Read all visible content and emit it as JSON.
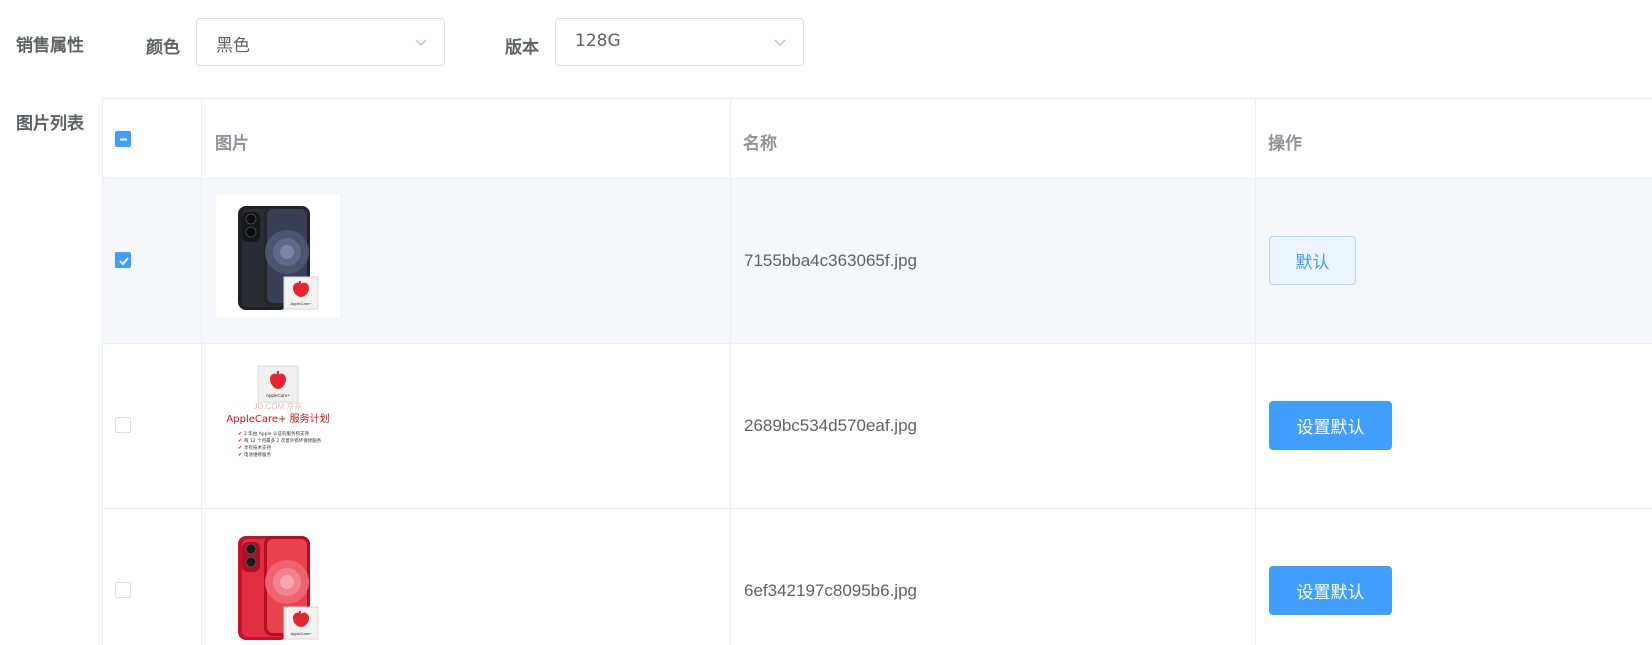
{
  "sales_attr": {
    "label": "销售属性",
    "color_label": "颜色",
    "color_value": "黑色",
    "version_label": "版本",
    "version_value": "128G"
  },
  "image_list": {
    "label": "图片列表",
    "columns": [
      "图片",
      "名称",
      "操作"
    ],
    "rows": [
      {
        "checked": true,
        "image_icon": "iphone-black-applecare-image",
        "name": "7155bba4c363065f.jpg",
        "action_label": "默认",
        "action_style": "plain"
      },
      {
        "checked": false,
        "image_icon": "applecare-service-plan-image",
        "image_text": {
          "badge": "AppleCare+",
          "site": "JD.COM 京东",
          "title": "AppleCare+ 服务计划",
          "lines": [
            "2 年由 Apple 认证的服务和支持",
            "每 12 个月最多 2 次意外损坏保修服务",
            "享有技术支持",
            "电池维修服务"
          ]
        },
        "name": "2689bc534d570eaf.jpg",
        "action_label": "设置默认",
        "action_style": "primary"
      },
      {
        "checked": false,
        "image_icon": "iphone-red-applecare-image",
        "name": "6ef342197c8095b6.jpg",
        "action_label": "设置默认",
        "action_style": "primary"
      }
    ]
  },
  "colors": {
    "accent": "#409eff",
    "border": "#ebeef5",
    "hover_row": "#f5f7fa",
    "header_text": "#909399",
    "body_text": "#606266"
  }
}
